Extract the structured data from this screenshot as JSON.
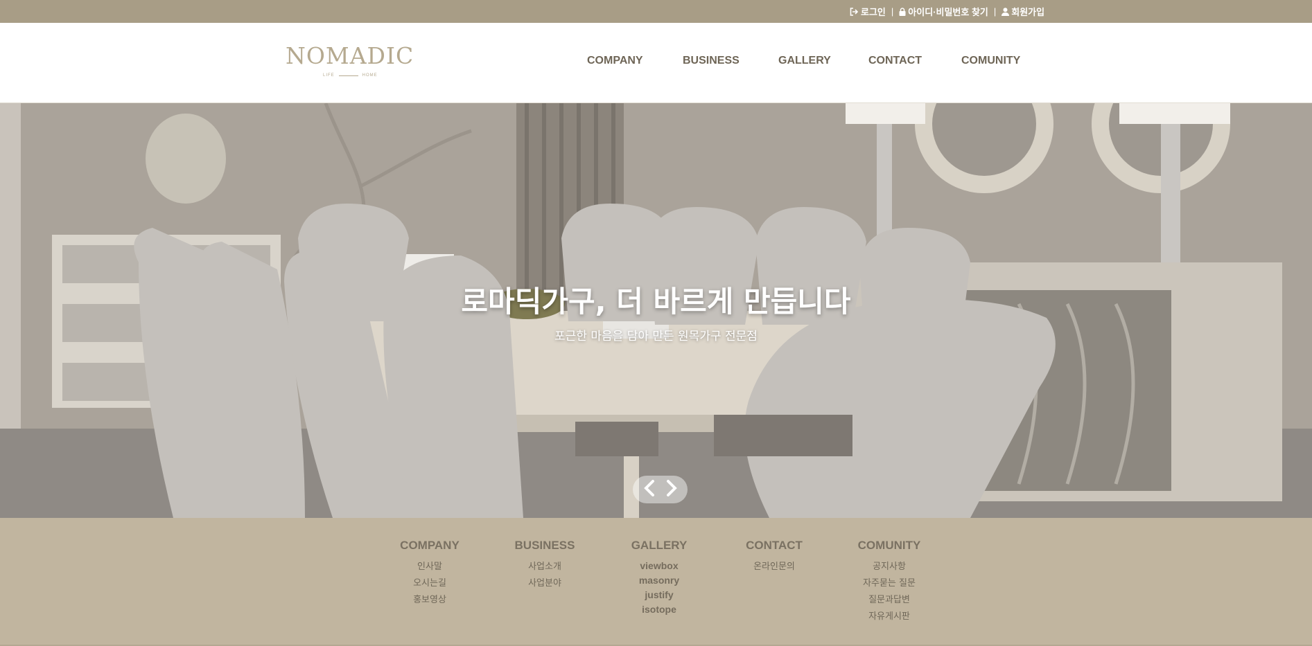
{
  "topbar": {
    "login": "로그인",
    "find": "아이디·비밀번호 찾기",
    "join": "회원가입",
    "separator": "|"
  },
  "logo": {
    "main": "NOMADIC",
    "sub_left": "LIFE",
    "sub_right": "HOME"
  },
  "nav": [
    "COMPANY",
    "BUSINESS",
    "GALLERY",
    "CONTACT",
    "COMUNITY"
  ],
  "hero": {
    "title": "로마딕가구, 더 바르게 만듭니다",
    "subtitle": "포근한 마음을 담아 만든 원목가구 전문점"
  },
  "sitemap": [
    {
      "title": "COMPANY",
      "items": [
        "인사말",
        "오시는길",
        "홍보영상"
      ]
    },
    {
      "title": "BUSINESS",
      "items": [
        "사업소개",
        "사업분야"
      ]
    },
    {
      "title": "GALLERY",
      "items": [
        "viewbox",
        "masonry",
        "justify",
        "isotope"
      ]
    },
    {
      "title": "CONTACT",
      "items": [
        "온라인문의"
      ]
    },
    {
      "title": "COMUNITY",
      "items": [
        "공지사항",
        "자주묻는 질문",
        "질문과답변",
        "자유게시판"
      ]
    }
  ],
  "colors": {
    "topbar": "#a89d86",
    "footer": "#c1b59f",
    "nav_text": "#6e6556",
    "logo": "#b5a98f"
  }
}
